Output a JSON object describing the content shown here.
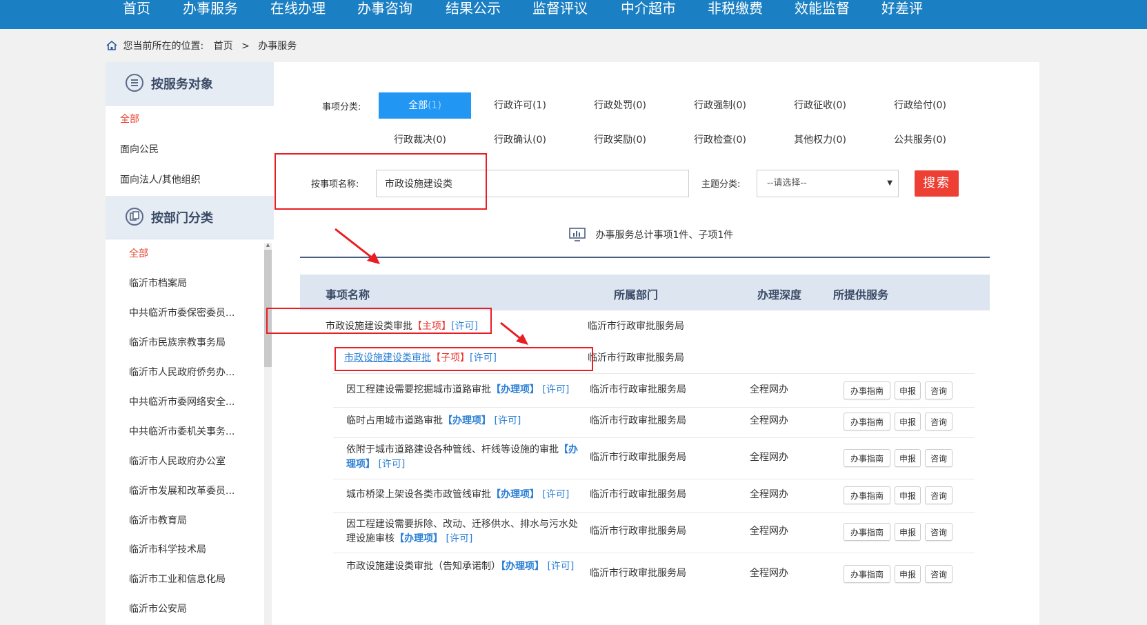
{
  "nav": {
    "items": [
      "首页",
      "办事服务",
      "在线办理",
      "办事咨询",
      "结果公示",
      "监督评议",
      "中介超市",
      "非税缴费",
      "效能监督",
      "好差评"
    ]
  },
  "breadcrumb": {
    "prefix": "您当前所在的位置:",
    "home": "首页",
    "separator": ">",
    "current": "办事服务"
  },
  "sidebar": {
    "by_target_title": "按服务对象",
    "target_items": [
      "全部",
      "面向公民",
      "面向法人/其他组织"
    ],
    "by_dept_title": "按部门分类",
    "dept_items": [
      "全部",
      "临沂市档案局",
      "中共临沂市委保密委员...",
      "临沂市民族宗教事务局",
      "临沂市人民政府侨务办...",
      "中共临沂市委网络安全...",
      "中共临沂市委机关事务...",
      "临沂市人民政府办公室",
      "临沂市发展和改革委员...",
      "临沂市教育局",
      "临沂市科学技术局",
      "临沂市工业和信息化局",
      "临沂市公安局"
    ]
  },
  "filters": {
    "category_label": "事项分类:",
    "categories": [
      {
        "name": "全部",
        "count": "(1)"
      },
      {
        "name": "行政许可",
        "count": "(1)"
      },
      {
        "name": "行政处罚",
        "count": "(0)"
      },
      {
        "name": "行政强制",
        "count": "(0)"
      },
      {
        "name": "行政征收",
        "count": "(0)"
      },
      {
        "name": "行政给付",
        "count": "(0)"
      },
      {
        "name": "行政裁决",
        "count": "(0)"
      },
      {
        "name": "行政确认",
        "count": "(0)"
      },
      {
        "name": "行政奖励",
        "count": "(0)"
      },
      {
        "name": "行政检查",
        "count": "(0)"
      },
      {
        "name": "其他权力",
        "count": "(0)"
      },
      {
        "name": "公共服务",
        "count": "(0)"
      }
    ],
    "name_label": "按事项名称:",
    "name_value": "市政设施建设类",
    "theme_label": "主题分类:",
    "theme_value": "--请选择--",
    "search_label": "搜索"
  },
  "summary": "办事服务总计事项1件、子项1件",
  "table": {
    "headers": [
      "事项名称",
      "所属部门",
      "办理深度",
      "所提供服务"
    ],
    "main_item": {
      "name": "市政设施建设类审批",
      "tag": "【主项】",
      "type": "[许可]",
      "dept": "临沂市行政审批服务局"
    },
    "sub_item": {
      "name": "市政设施建设类审批",
      "tag": "【子项】",
      "type": "[许可]",
      "dept": "临沂市行政审批服务局"
    },
    "rows": [
      {
        "name": "因工程建设需要挖掘城市道路审批",
        "tag": "【办理项】",
        "type": "[许可]",
        "dept": "临沂市行政审批服务局",
        "depth": "全程网办"
      },
      {
        "name": "临时占用城市道路审批",
        "tag": "【办理项】",
        "type": "[许可]",
        "dept": "临沂市行政审批服务局",
        "depth": "全程网办"
      },
      {
        "name": "依附于城市道路建设各种管线、杆线等设施的审批",
        "tag": "【办理项】",
        "type": "[许可]",
        "dept": "临沂市行政审批服务局",
        "depth": "全程网办"
      },
      {
        "name": "城市桥梁上架设各类市政管线审批",
        "tag": "【办理项】",
        "type": "[许可]",
        "dept": "临沂市行政审批服务局",
        "depth": "全程网办"
      },
      {
        "name": "因工程建设需要拆除、改动、迁移供水、排水与污水处理设施审核",
        "tag": "【办理项】",
        "type": "[许可]",
        "dept": "临沂市行政审批服务局",
        "depth": "全程网办"
      },
      {
        "name": "市政设施建设类审批（告知承诺制）",
        "tag": "【办理项】",
        "type": "[许可]",
        "dept": "临沂市行政审批服务局",
        "depth": "全程网办"
      }
    ],
    "services": [
      "办事指南",
      "申报",
      "咨询"
    ]
  },
  "colors": {
    "nav_bg": "#1a7fc3",
    "active_cat": "#2196f3",
    "search_btn": "#ee3f34",
    "annotation": "#ea1c24",
    "link": "#2a7fd4",
    "red_tag": "#e8322c"
  }
}
